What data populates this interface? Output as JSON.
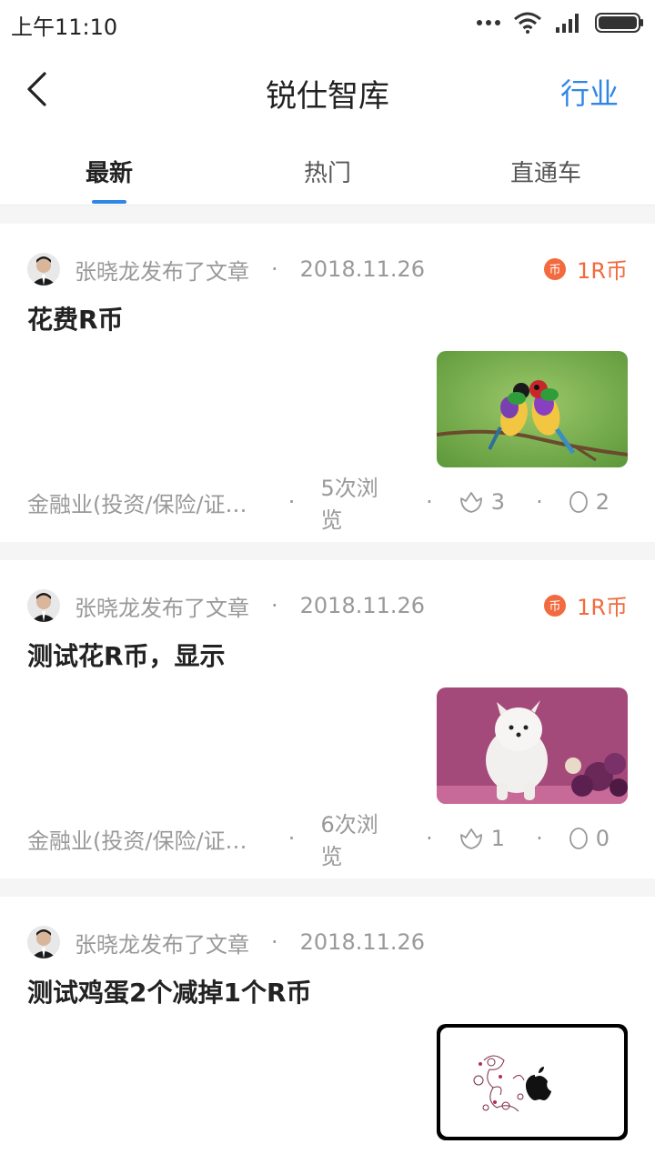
{
  "status_bar": {
    "time": "上午11:10",
    "icons": [
      "more-dots-icon",
      "wifi-icon",
      "signal-icon",
      "battery-icon"
    ]
  },
  "nav": {
    "title": "锐仕智库",
    "action": "行业",
    "back_icon": "chevron-left-icon"
  },
  "tabs": [
    {
      "label": "最新",
      "active": true
    },
    {
      "label": "热门",
      "active": false
    },
    {
      "label": "直通车",
      "active": false
    }
  ],
  "colors": {
    "accent": "#2f86e6",
    "coin": "#f26a3d",
    "muted_text": "#999999",
    "divider": "#f5f5f5"
  },
  "separator": "·",
  "articles": [
    {
      "author": "张晓龙发布了文章",
      "date": "2018.11.26",
      "coin": "1R币",
      "coin_icon_text": "币",
      "title": "花费R币",
      "thumbnail": "birds-photo",
      "category": "金融业(投资/保险/证券/银行)",
      "views": "5次浏览",
      "likes": "3",
      "comments": "2"
    },
    {
      "author": "张晓龙发布了文章",
      "date": "2018.11.26",
      "coin": "1R币",
      "coin_icon_text": "币",
      "title": "测试花R币，显示",
      "thumbnail": "dog-photo",
      "category": "金融业(投资/保险/证券/银行)",
      "views": "6次浏览",
      "likes": "1",
      "comments": "0"
    },
    {
      "author": "张晓龙发布了文章",
      "date": "2018.11.26",
      "coin": "",
      "title": "测试鸡蛋2个减掉1个R币",
      "thumbnail": "floral-apple-image",
      "category": "",
      "views": "",
      "likes": "",
      "comments": ""
    }
  ]
}
